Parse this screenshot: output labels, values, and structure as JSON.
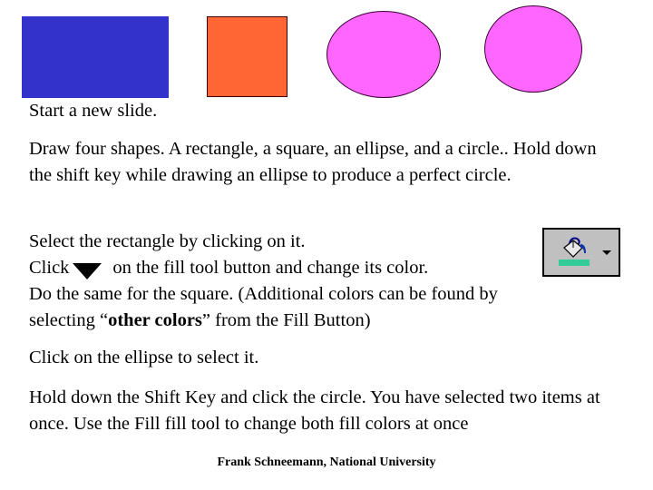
{
  "shapes": {
    "rectangle": {
      "label": "rectangle",
      "color": "#3333cc"
    },
    "square": {
      "label": "square",
      "color": "#ff6633"
    },
    "ellipse": {
      "label": "ellipse",
      "color": "#ff66ff"
    },
    "circle": {
      "label": "circle",
      "color": "#ff66ff"
    }
  },
  "instructions": {
    "p1": "Start a new slide.",
    "p2": "Draw four shapes. A rectangle, a square, an ellipse, and a circle.. Hold down the shift key while drawing an ellipse to produce a perfect circle.",
    "p3_line1": "Select the rectangle by clicking on it.",
    "p3_click": "Click",
    "p3_click_rest": "on the fill tool button and change its color.",
    "p3_line3": "Do the same for the square. (Additional colors can be found by",
    "p3_line4_pre": "selecting “",
    "p3_line4_bold": "other colors",
    "p3_line4_post": "” from the Fill Button)",
    "p4": "Click on the ellipse to select it.",
    "p5": "Hold down the Shift Key and click the circle. You have selected two items at once.  Use the Fill fill tool to change both fill colors at once"
  },
  "fill_button": {
    "icon": "paint-bucket-icon",
    "swatch_color": "#33cc99",
    "dropdown": "dropdown-arrow-icon"
  },
  "footer": "Frank Schneemann, National University"
}
